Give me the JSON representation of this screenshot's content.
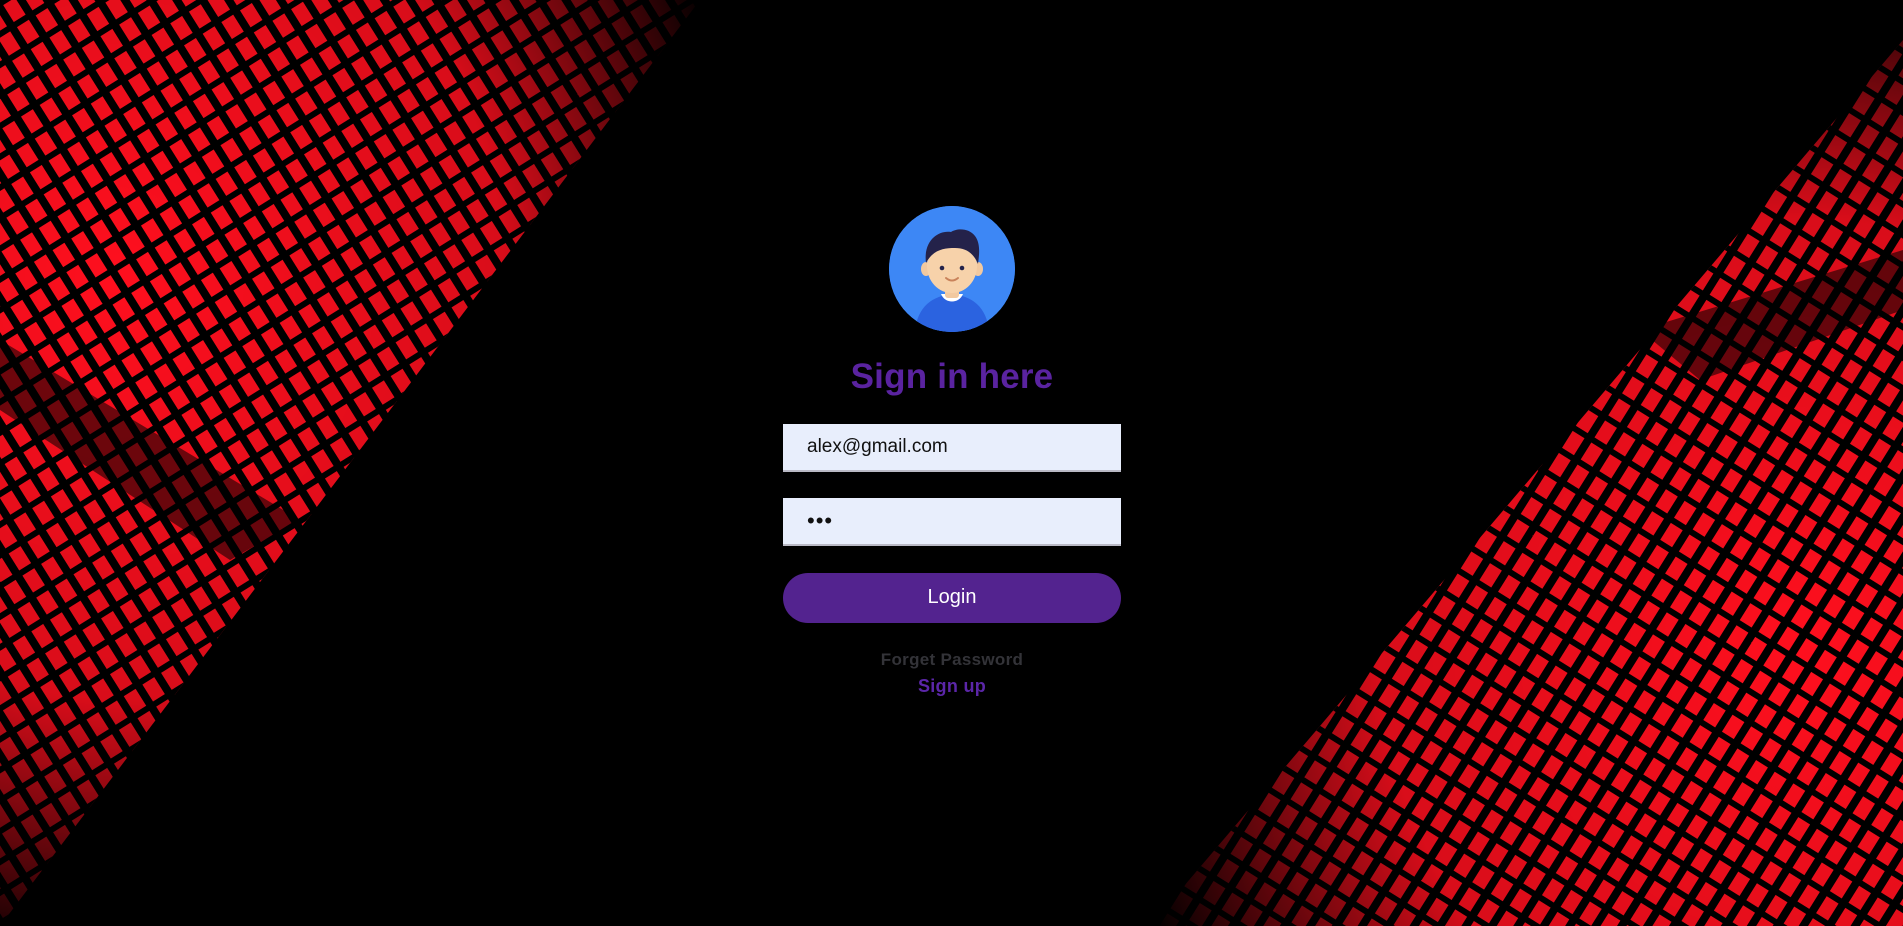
{
  "colors": {
    "background": "#000000",
    "accent_red": "#ff0f1e",
    "title": "#5a23a0",
    "button": "#53238f",
    "input_bg": "#e8eefc",
    "avatar_bg": "#3d87f5",
    "forget_text": "#333338",
    "signup_text": "#5b26a8"
  },
  "login": {
    "avatar_icon": "user-avatar-icon",
    "title": "Sign in here",
    "email_value": "alex@gmail.com",
    "password_value": "•••",
    "login_label": "Login",
    "forget_label": "Forget Password",
    "signup_label": "Sign up"
  }
}
